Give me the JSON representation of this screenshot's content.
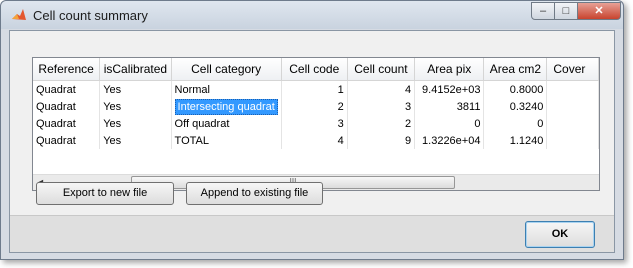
{
  "window": {
    "title": "Cell count summary",
    "caption_min": "–",
    "caption_max": "□",
    "caption_close": "✕"
  },
  "table": {
    "columns": [
      "Reference",
      "isCalibrated",
      "Cell category",
      "Cell code",
      "Cell count",
      "Area pix",
      "Area cm2",
      "Cover"
    ],
    "rows": [
      [
        "Quadrat",
        "Yes",
        "Normal",
        "1",
        "4",
        "9.4152e+03",
        "0.8000",
        ""
      ],
      [
        "Quadrat",
        "Yes",
        "Intersecting quadrat",
        "2",
        "3",
        "3811",
        "0.3240",
        ""
      ],
      [
        "Quadrat",
        "Yes",
        "Off quadrat",
        "3",
        "2",
        "0",
        "0",
        ""
      ],
      [
        "Quadrat",
        "Yes",
        "TOTAL",
        "4",
        "9",
        "1.3226e+04",
        "1.1240",
        ""
      ]
    ],
    "scroll_left": "◄",
    "scroll_grip": "III"
  },
  "buttons": {
    "export": "Export to new file",
    "append": "Append to existing file",
    "ok": "OK"
  },
  "colors": {
    "selection": "#3399ff",
    "close_button": "#c8432e"
  }
}
